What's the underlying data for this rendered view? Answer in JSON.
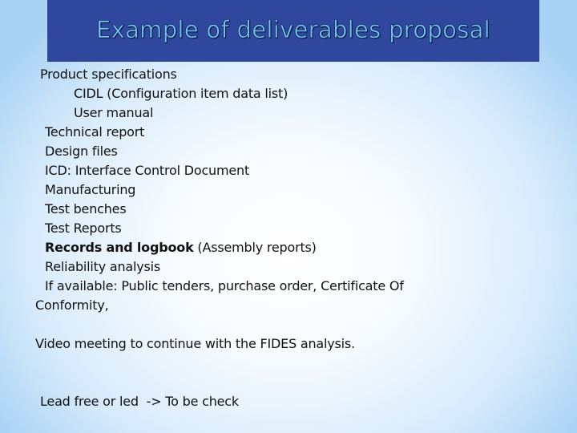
{
  "slide": {
    "title": "Example of deliverables proposal",
    "items": [
      {
        "text": "Product specifications"
      },
      {
        "text": "CIDL (Configuration item data list)"
      },
      {
        "text": "User manual"
      },
      {
        "text": "Technical report"
      },
      {
        "text": "Design files"
      },
      {
        "text": "ICD: Interface Control Document"
      },
      {
        "text": "Manufacturing"
      },
      {
        "text": "Test benches"
      },
      {
        "text": "Test Reports"
      },
      {
        "bold": "Records and logbook",
        "text": " (Assembly reports)"
      },
      {
        "text": "Reliability analysis"
      },
      {
        "text": "If available: Public tenders, purchase order, Certificate Of"
      },
      {
        "text": "Conformity,"
      }
    ],
    "video_meeting": "Video meeting to continue with the FIDES analysis.",
    "lead_note": "Lead free or led  -> To be check"
  }
}
